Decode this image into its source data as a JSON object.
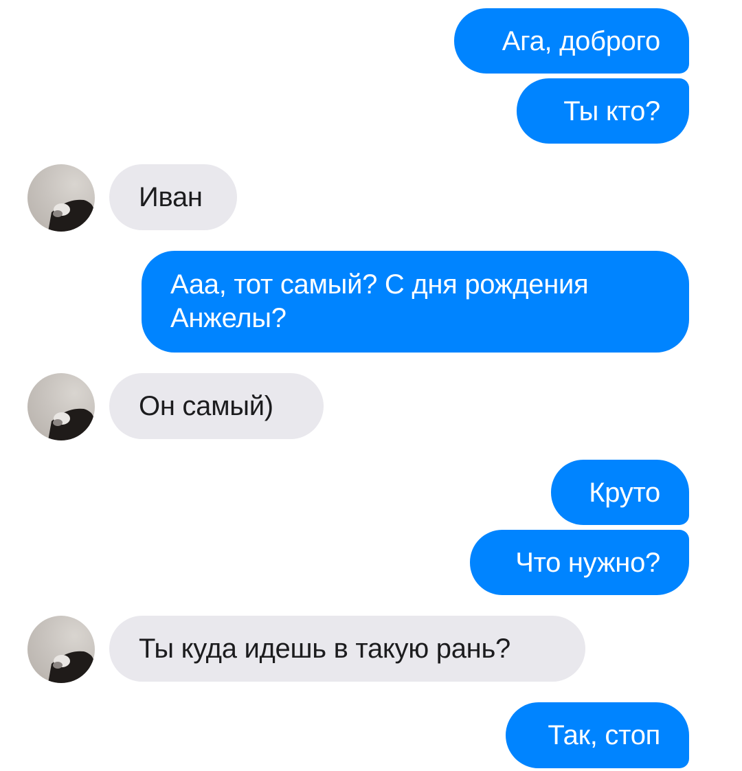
{
  "conversation": {
    "messages": [
      {
        "sender": "me",
        "text": "Ага, доброго"
      },
      {
        "sender": "me",
        "text": "Ты кто?"
      },
      {
        "sender": "contact",
        "text": "Иван"
      },
      {
        "sender": "me",
        "text": "Ааа, тот самый? С дня рождения Анжелы?"
      },
      {
        "sender": "contact",
        "text": "Он самый)"
      },
      {
        "sender": "me",
        "text": "Круто"
      },
      {
        "sender": "me",
        "text": "Что нужно?"
      },
      {
        "sender": "contact",
        "text": "Ты куда идешь в такую рань?"
      },
      {
        "sender": "me",
        "text": "Так, стоп"
      }
    ]
  },
  "contact": {
    "avatar_icon": "contact-avatar-photo"
  },
  "colors": {
    "outgoing_bubble": "#0084ff",
    "incoming_bubble": "#e9e8ed",
    "outgoing_text": "#ffffff",
    "incoming_text": "#1c1c1e"
  }
}
